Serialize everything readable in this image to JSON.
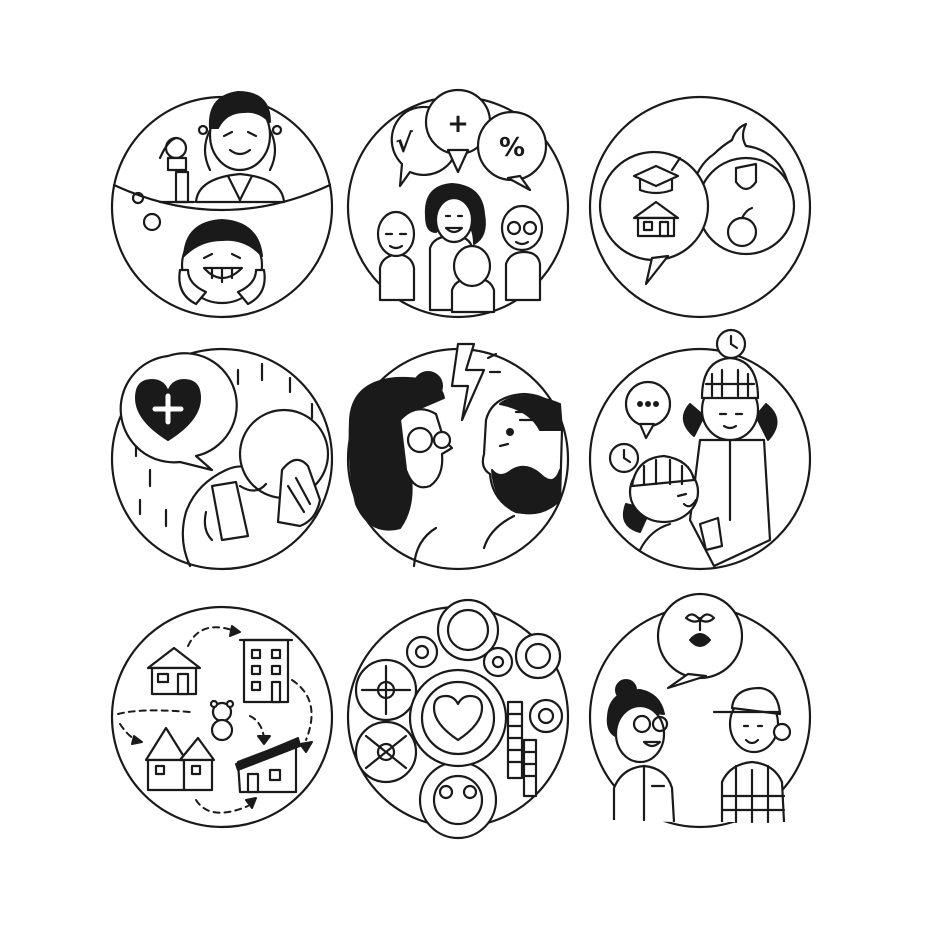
{
  "image": {
    "style": "black line-art icon set on white",
    "palette": {
      "stroke": "#1a1a1a",
      "fill": "#1a1a1a",
      "background": "#ffffff"
    }
  },
  "tiles": [
    {
      "id": "doctor",
      "icons": [
        "doctor-with-stethoscope",
        "microscope",
        "thought-bubble",
        "happy-patient"
      ]
    },
    {
      "id": "math-group",
      "symbols": {
        "sqrt": "√",
        "plus": "+",
        "percent": "%"
      }
    },
    {
      "id": "speech-bubbles",
      "icons": [
        "graduation-cap",
        "house",
        "shield",
        "apple"
      ]
    },
    {
      "id": "health-call",
      "icons": [
        "heart-plus-bubble",
        "phone",
        "rain",
        "two-people"
      ]
    },
    {
      "id": "conflict",
      "icons": [
        "lightning-bolt",
        "woman-with-glasses",
        "bearded-man"
      ]
    },
    {
      "id": "kids-waiting",
      "icons": [
        "clock",
        "ellipsis-bubble",
        "child",
        "girl-with-beanie"
      ]
    },
    {
      "id": "housing-path",
      "icons": [
        "house",
        "apartment-building",
        "teddy-bear",
        "townhouse",
        "dashed-arrows"
      ]
    },
    {
      "id": "gears-heart",
      "icons": [
        "gears",
        "heart",
        "coin-stack"
      ]
    },
    {
      "id": "farmers",
      "icons": [
        "sprout-bubble",
        "woman-with-glasses",
        "man-in-cap"
      ]
    }
  ]
}
